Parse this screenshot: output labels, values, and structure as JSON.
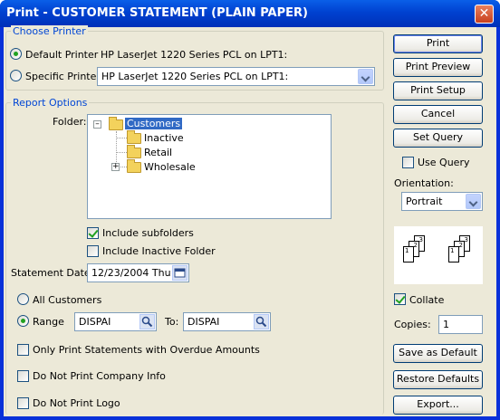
{
  "window": {
    "title": "Print - CUSTOMER STATEMENT (PLAIN PAPER)",
    "close_symbol": "✕"
  },
  "choose_printer": {
    "legend": "Choose Printer",
    "default_label": "Default Printer",
    "default_value": "HP LaserJet 1220 Series PCL on LPT1:",
    "specific_label": "Specific Printer",
    "specific_value": "HP LaserJet 1220 Series PCL on LPT1:"
  },
  "report_options": {
    "legend": "Report Options",
    "folder_label": "Folder:",
    "tree": {
      "root": "Customers",
      "children": [
        "Inactive",
        "Retail",
        "Wholesale"
      ]
    },
    "include_subfolders": {
      "label": "Include subfolders",
      "checked": true
    },
    "include_inactive": {
      "label": "Include Inactive Folder",
      "checked": false
    },
    "statement_date_label": "Statement Date:",
    "statement_date_value": "12/23/2004 Thu",
    "all_customers_label": "All Customers",
    "range_label": "Range",
    "range_from": "DISPAI",
    "to_label": "To:",
    "range_to": "DISPAI",
    "only_overdue": {
      "label": "Only Print Statements with Overdue Amounts",
      "checked": false
    },
    "no_company_info": {
      "label": "Do Not Print Company Info",
      "checked": false
    },
    "no_logo": {
      "label": "Do Not Print Logo",
      "checked": false
    }
  },
  "side": {
    "print": "Print",
    "print_preview": "Print Preview",
    "print_setup": "Print Setup",
    "cancel": "Cancel",
    "set_query": "Set Query",
    "use_query": {
      "label": "Use Query",
      "checked": false
    },
    "orientation_label": "Orientation:",
    "orientation_value": "Portrait",
    "collate": {
      "label": "Collate",
      "checked": true
    },
    "copies_label": "Copies:",
    "copies_value": "1",
    "save_default": "Save as Default",
    "restore_defaults": "Restore Defaults",
    "export": "Export..."
  },
  "collate_pages": [
    "1",
    "2",
    "3",
    "1",
    "2",
    "3"
  ],
  "colors": {
    "title_bar": "#0041d0",
    "dialog_bg": "#ece9d8",
    "legend_text": "#0046d5",
    "check_mark": "#21a121"
  },
  "icons": [
    "close-icon",
    "folder-icon",
    "expand-icon",
    "search-icon",
    "calendar-icon",
    "chevron-down-icon"
  ]
}
